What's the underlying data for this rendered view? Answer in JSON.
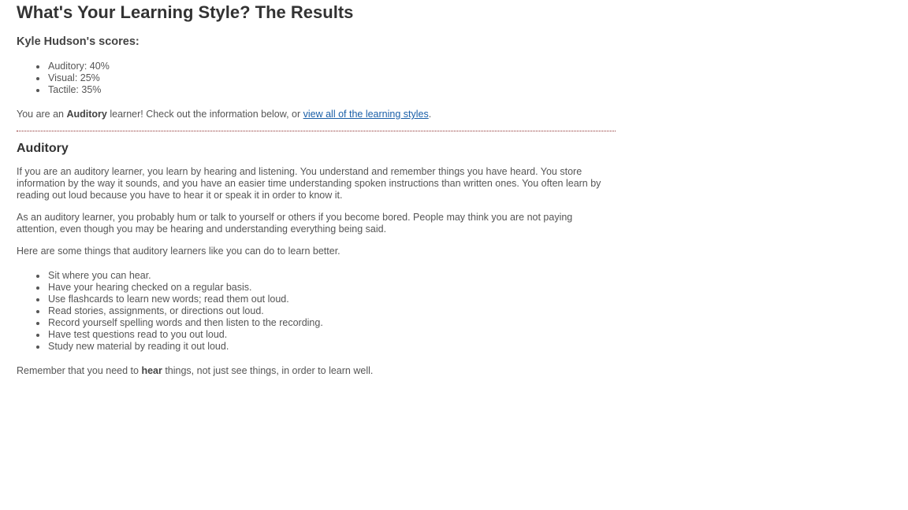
{
  "page": {
    "title": "What's Your Learning Style? The Results"
  },
  "scores": {
    "heading": "Kyle Hudson's scores:",
    "items": [
      "Auditory: 40%",
      "Visual: 25%",
      "Tactile: 35%"
    ]
  },
  "result": {
    "prefix": "You are an ",
    "style": "Auditory",
    "middle": " learner! Check out the information below, or ",
    "link_text": "view all of the learning styles",
    "suffix": "."
  },
  "section": {
    "heading": "Auditory",
    "paragraphs": [
      "If you are an auditory learner, you learn by hearing and listening. You understand and remember things you have heard. You store information by the way it sounds, and you have an easier time understanding spoken instructions than written ones. You often learn by reading out loud because you have to hear it or speak it in order to know it.",
      "As an auditory learner, you probably hum or talk to yourself or others if you become bored. People may think you are not paying attention, even though you may be hearing and understanding everything being said.",
      "Here are some things that auditory learners like you can do to learn better."
    ],
    "tips": [
      "Sit where you can hear.",
      "Have your hearing checked on a regular basis.",
      "Use flashcards to learn new words; read them out loud.",
      "Read stories, assignments, or directions out loud.",
      "Record yourself spelling words and then listen to the recording.",
      "Have test questions read to you out loud.",
      "Study new material by reading it out loud."
    ],
    "closing": {
      "prefix": "Remember that you need to ",
      "emphasis": "hear",
      "suffix": " things, not just see things, in order to learn well."
    }
  },
  "colors": {
    "text": "#555555",
    "heading": "#333333",
    "link": "#1a5fa8",
    "divider": "#8b2b2b"
  }
}
